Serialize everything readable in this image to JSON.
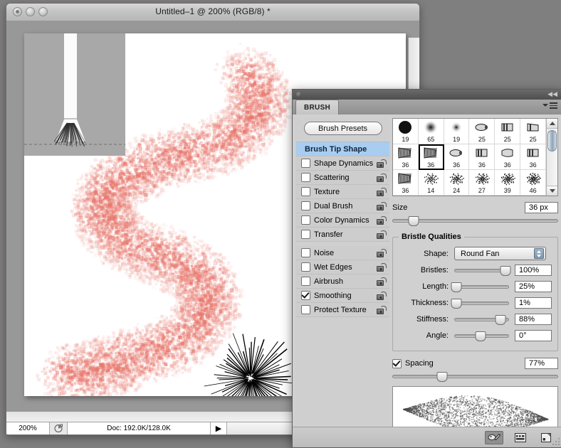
{
  "document_window": {
    "title": "Untitled–1 @ 200% (RGB/8) *",
    "traffic_lights": [
      "close",
      "minimize",
      "zoom"
    ],
    "status_bar": {
      "zoom_level": "200%",
      "doc_icon": "document-size-icon",
      "doc_info": "Doc: 192.0K/128.0K",
      "arrow": "▶"
    },
    "canvas": {
      "stroke_color": "#e8756a",
      "starburst_color": "#000000",
      "brush_cursor_preview": {
        "panel_color": "#a8a8a8",
        "handle_color": "#fbfbfb",
        "bristle_color": "#2b2b2b"
      }
    }
  },
  "panel": {
    "grip_icon": "panel-grip-dot",
    "collapse_icon": "double-chevron-collapse-icon",
    "tab_label": "BRUSH",
    "menu_icon": "panel-menu-icon",
    "brush_presets_button": "Brush Presets",
    "options": [
      {
        "label": "Brush Tip Shape",
        "type": "header",
        "selected": true,
        "lock": false
      },
      {
        "label": "Shape Dynamics",
        "type": "check",
        "checked": false,
        "lock": true
      },
      {
        "label": "Scattering",
        "type": "check",
        "checked": false,
        "lock": true
      },
      {
        "label": "Texture",
        "type": "check",
        "checked": false,
        "lock": true
      },
      {
        "label": "Dual Brush",
        "type": "check",
        "checked": false,
        "lock": true
      },
      {
        "label": "Color Dynamics",
        "type": "check",
        "checked": false,
        "lock": true
      },
      {
        "label": "Transfer",
        "type": "check",
        "checked": false,
        "lock": true
      },
      {
        "label": "Noise",
        "type": "check",
        "checked": false,
        "lock": true
      },
      {
        "label": "Wet Edges",
        "type": "check",
        "checked": false,
        "lock": true
      },
      {
        "label": "Airbrush",
        "type": "check",
        "checked": false,
        "lock": true
      },
      {
        "label": "Smoothing",
        "type": "check",
        "checked": true,
        "lock": true
      },
      {
        "label": "Protect Texture",
        "type": "check",
        "checked": false,
        "lock": true
      }
    ],
    "brush_grid": {
      "selected_index": 7,
      "cells": [
        {
          "size": "19",
          "icon": "round-hard-brush-icon"
        },
        {
          "size": "65",
          "icon": "soft-round-brush-icon"
        },
        {
          "size": "19",
          "icon": "soft-round-small-brush-icon"
        },
        {
          "size": "25",
          "icon": "bristle-round-point-icon"
        },
        {
          "size": "25",
          "icon": "bristle-flat-icon"
        },
        {
          "size": "25",
          "icon": "bristle-angle-icon"
        },
        {
          "size": "36",
          "icon": "bristle-flat-fan-icon"
        },
        {
          "size": "36",
          "icon": "bristle-round-fan-icon"
        },
        {
          "size": "36",
          "icon": "bristle-round-blunt-icon"
        },
        {
          "size": "36",
          "icon": "bristle-flat-blunt-icon"
        },
        {
          "size": "36",
          "icon": "bristle-round-curve-icon"
        },
        {
          "size": "36",
          "icon": "bristle-flat-curve-icon"
        },
        {
          "size": "36",
          "icon": "bristle-fan-left-icon"
        },
        {
          "size": "14",
          "icon": "spatter-small-icon"
        },
        {
          "size": "24",
          "icon": "spatter-medium-icon"
        },
        {
          "size": "27",
          "icon": "spatter-dense-icon"
        },
        {
          "size": "39",
          "icon": "spatter-large-icon"
        },
        {
          "size": "46",
          "icon": "spatter-xlarge-icon"
        }
      ],
      "scrollbar": {
        "up_arrow": "scroll-up-icon",
        "down_arrow": "scroll-down-icon"
      }
    },
    "size": {
      "label": "Size",
      "value": "36 px",
      "slider_percent": 13
    },
    "bristle_qualities": {
      "legend": "Bristle Qualities",
      "shape": {
        "label": "Shape:",
        "value": "Round Fan"
      },
      "rows": [
        {
          "label": "Bristles:",
          "value": "100%",
          "slider_percent": 93
        },
        {
          "label": "Length:",
          "value": "25%",
          "slider_percent": 4
        },
        {
          "label": "Thickness:",
          "value": "1%",
          "slider_percent": 4
        },
        {
          "label": "Stiffness:",
          "value": "88%",
          "slider_percent": 84
        },
        {
          "label": "Angle:",
          "value": "0°",
          "slider_percent": 48
        }
      ]
    },
    "spacing": {
      "label": "Spacing",
      "checked": true,
      "value": "77%",
      "slider_percent": 30
    },
    "stroke_preview": {
      "icon": "brush-stroke-preview"
    },
    "footer_buttons": [
      {
        "icon": "brush-palette-toggle-icon",
        "active": true
      },
      {
        "icon": "brush-grid-view-icon",
        "active": false
      },
      {
        "icon": "new-brush-icon",
        "active": false
      }
    ]
  },
  "colors": {
    "desktop": "#807f7f",
    "panel_bg": "#d0d0d0",
    "selection_blue": "#a8cdf0",
    "stroke_pink": "#e8756a"
  }
}
